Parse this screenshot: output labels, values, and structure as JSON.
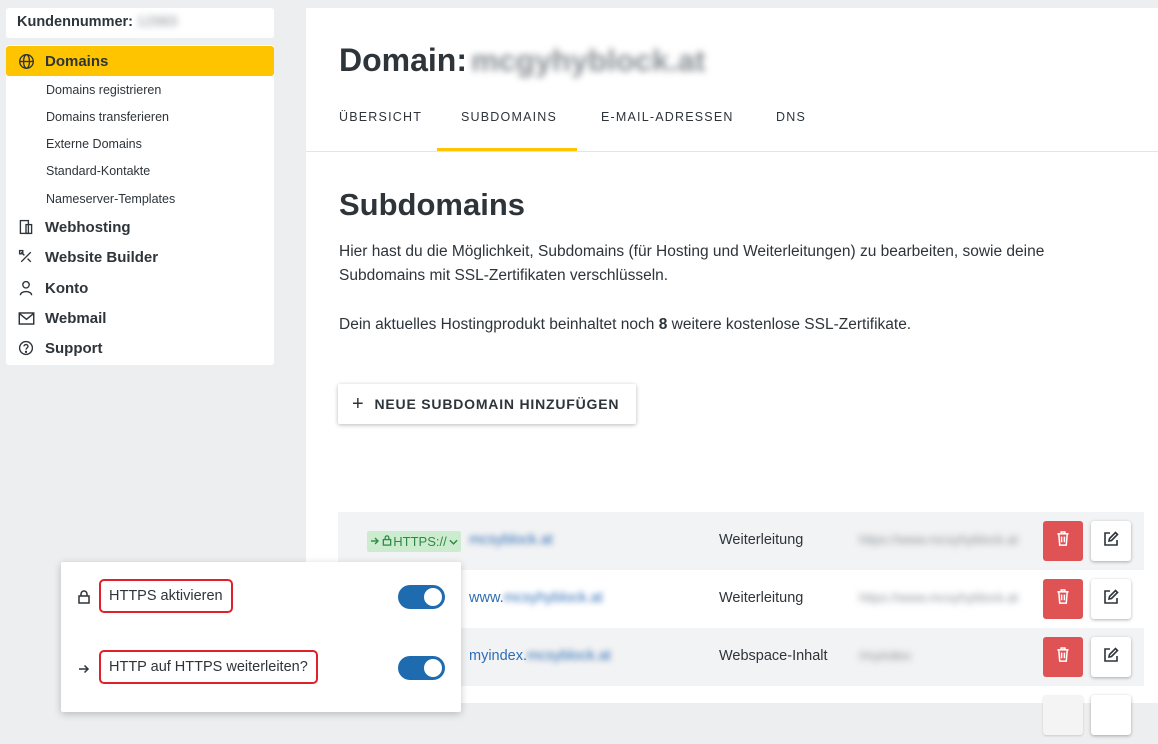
{
  "sidebar": {
    "customer_label": "Kundennummer:",
    "customer_value": "12983",
    "nav": [
      {
        "label": "Domains",
        "icon": "globe-icon",
        "active": true
      },
      {
        "label": "Webhosting",
        "icon": "hosting-icon"
      },
      {
        "label": "Website Builder",
        "icon": "tools-icon"
      },
      {
        "label": "Konto",
        "icon": "user-icon"
      },
      {
        "label": "Webmail",
        "icon": "mail-icon"
      },
      {
        "label": "Support",
        "icon": "help-icon"
      }
    ],
    "domains_sub": [
      "Domains registrieren",
      "Domains transferieren",
      "Externe Domains",
      "Standard-Kontakte",
      "Nameserver-Templates"
    ]
  },
  "header": {
    "title_prefix": "Domain:",
    "domain_name": "mcgyhyblock.at"
  },
  "tabs": [
    {
      "label": "ÜBERSICHT"
    },
    {
      "label": "SUBDOMAINS",
      "active": true
    },
    {
      "label": "E-MAIL-ADRESSEN"
    },
    {
      "label": "DNS"
    }
  ],
  "content": {
    "title": "Subdomains",
    "intro": "Hier hast du die Möglichkeit, Subdomains (für Hosting und Weiterleitungen) zu bearbeiten, sowie deine Subdomains mit SSL-Zertifikaten verschlüsseln.",
    "ssl_prefix": "Dein aktuelles Hostingprodukt beinhaltet noch",
    "ssl_count": "8",
    "ssl_suffix": "weitere kostenlose SSL-Zertifikate.",
    "add_button": "NEUE SUBDOMAIN HINZUFÜGEN"
  },
  "https_badge": "HTTPS://",
  "subdomains": [
    {
      "name_visible": "",
      "name_hidden": "mcsyblock.at",
      "type": "Weiterleitung",
      "target": "https://www.mcsyhyblock.at"
    },
    {
      "name_visible": "www.",
      "name_hidden": "mcsyhyblock.at",
      "type": "Weiterleitung",
      "target": "https://www.mcsyhyblock.at"
    },
    {
      "name_visible": "myindex.",
      "name_hidden": "mcsyblock.at",
      "type": "Webspace-Inhalt",
      "target": "/myindex"
    }
  ],
  "popup": {
    "https_label": "HTTPS aktivieren",
    "https_enabled": true,
    "redirect_label": "HTTP auf HTTPS weiterleiten?",
    "redirect_enabled": true
  },
  "colors": {
    "accent": "#ffc400",
    "link": "#2f6db5",
    "danger": "#e05355",
    "toggle_on": "#1f6bb0",
    "badge_bg": "#cdeccf"
  }
}
